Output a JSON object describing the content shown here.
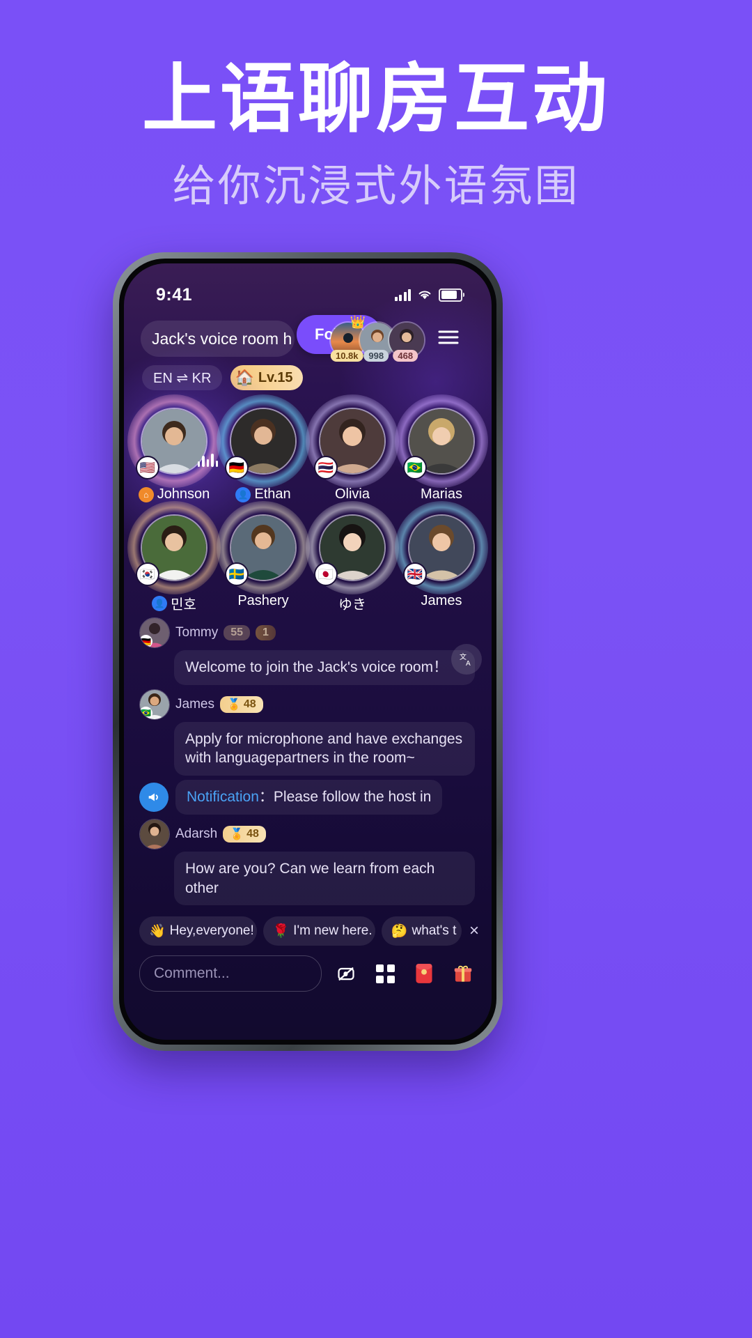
{
  "poster": {
    "headline": "上语聊房互动",
    "subhead": "给你沉浸式外语氛围",
    "bg_color": "#7b52f5"
  },
  "status_bar": {
    "time": "9:41",
    "signal_icon": "signal-bars-icon",
    "wifi_icon": "wifi-icon",
    "battery_icon": "battery-icon"
  },
  "room_header": {
    "room_name": "Jack's voice room h",
    "follow_label": "Follow",
    "menu_icon": "hamburger-menu-icon",
    "viewers": [
      {
        "badge": "10.8k",
        "badge_style": "gold",
        "crown": "👑"
      },
      {
        "badge": "998",
        "badge_style": "grey",
        "crown": ""
      },
      {
        "badge": "468",
        "badge_style": "pink",
        "crown": ""
      }
    ]
  },
  "tags": {
    "language": "EN ⇌ KR",
    "level": "Lv.15",
    "level_icon": "🏠"
  },
  "seats": [
    {
      "name": "Johnson",
      "flag": "🇺🇸",
      "role_icon": "host",
      "is_host": true,
      "speaking": true
    },
    {
      "name": "Ethan",
      "flag": "🇩🇪",
      "role_icon": "user",
      "is_host": false,
      "speaking": false
    },
    {
      "name": "Olivia",
      "flag": "🇹🇭",
      "role_icon": "",
      "is_host": false,
      "speaking": false
    },
    {
      "name": "Marias",
      "flag": "🇧🇷",
      "role_icon": "",
      "is_host": false,
      "speaking": false
    },
    {
      "name": "민호",
      "flag": "🇰🇷",
      "role_icon": "user",
      "is_host": false,
      "speaking": false
    },
    {
      "name": "Pashery",
      "flag": "🇸🇪",
      "role_icon": "",
      "is_host": false,
      "speaking": false
    },
    {
      "name": "ゆき",
      "flag": "🇯🇵",
      "role_icon": "",
      "is_host": false,
      "speaking": false
    },
    {
      "name": "James",
      "flag": "🇬🇧",
      "role_icon": "",
      "is_host": false,
      "speaking": false
    }
  ],
  "chat": {
    "translate_icon": "translate-icon",
    "messages": [
      {
        "type": "user",
        "name": "Tommy",
        "level": "55",
        "extra_badge": "1",
        "dim": true,
        "text": "Welcome to join the Jack's voice room！"
      },
      {
        "type": "user",
        "name": "James",
        "level": "48",
        "extra_badge": "",
        "dim": false,
        "text": "Apply for microphone and have exchanges with languagepartners in the room~"
      },
      {
        "type": "notification",
        "label": "Notification",
        "separator": "：",
        "text": "Please follow the host in",
        "icon": "megaphone-icon"
      },
      {
        "type": "user",
        "name": "Adarsh",
        "level": "48",
        "extra_badge": "",
        "dim": false,
        "text": "How are you? Can we learn from each other"
      }
    ]
  },
  "quick_replies": [
    {
      "emoji": "👋",
      "label": "Hey,everyone!"
    },
    {
      "emoji": "🌹",
      "label": "I'm new here."
    },
    {
      "emoji": "🤔",
      "label": "what's t"
    }
  ],
  "quick_close_icon": "close-icon",
  "input_bar": {
    "placeholder": "Comment...",
    "icons": [
      "mute-mic-icon",
      "apps-grid-icon",
      "red-packet-icon",
      "gift-icon"
    ]
  }
}
